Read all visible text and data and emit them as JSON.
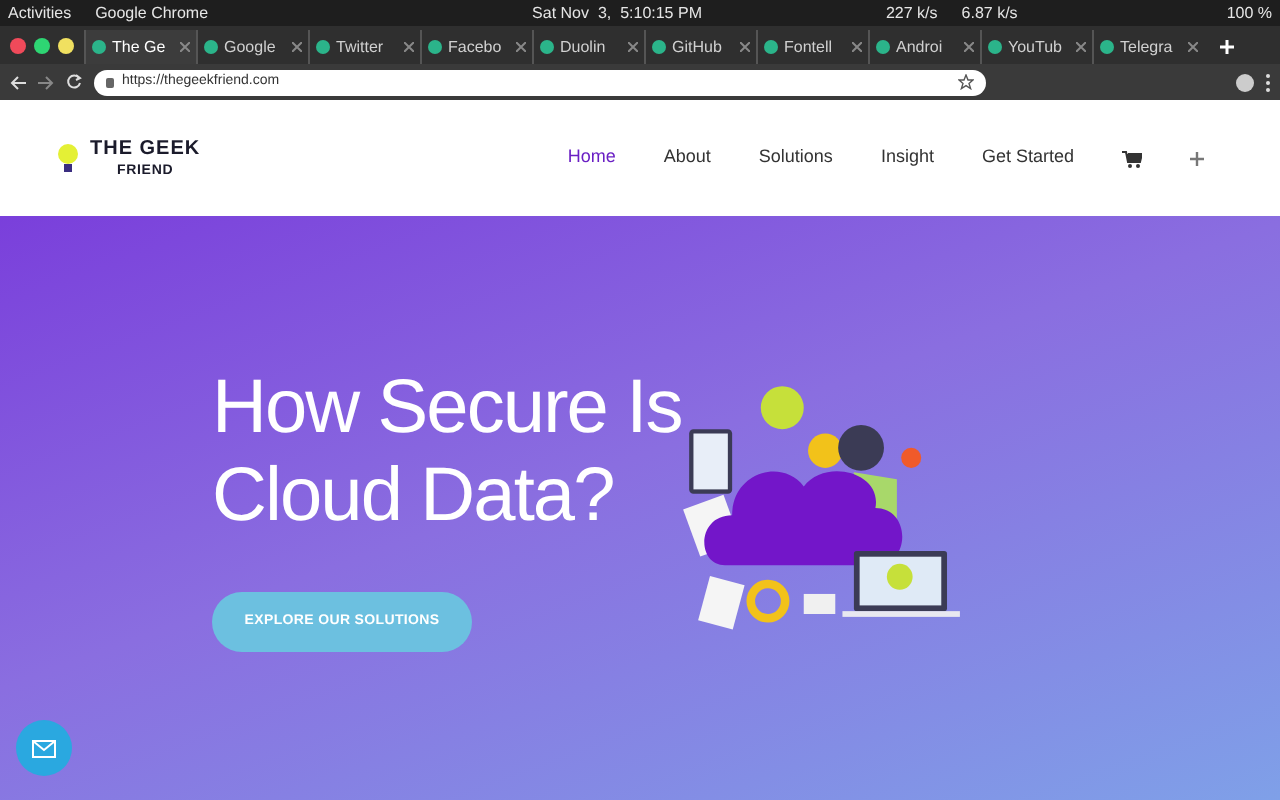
{
  "os_bar": {
    "activities": "Activities",
    "app": "Google Chrome",
    "clock": "Sat Nov  3,  5:10:15 PM",
    "download": "227 k/s",
    "upload": "6.87 k/s",
    "battery": "100 %"
  },
  "tabs": [
    {
      "label": "The Ge",
      "selected": true
    },
    {
      "label": "Google",
      "selected": false
    },
    {
      "label": "Twitter",
      "selected": false
    },
    {
      "label": "Facebo",
      "selected": false
    },
    {
      "label": "Duolin",
      "selected": false
    },
    {
      "label": "GitHub",
      "selected": false
    },
    {
      "label": "Fontell",
      "selected": false
    },
    {
      "label": "Androi",
      "selected": false
    },
    {
      "label": "YouTub",
      "selected": false
    },
    {
      "label": "Telegra",
      "selected": false
    }
  ],
  "address_bar": {
    "url": "https://thegeekfriend.com"
  },
  "site": {
    "logo_line1": "THE GEEK",
    "logo_line2": "FRIEND",
    "nav": [
      {
        "label": "Home",
        "selected": true
      },
      {
        "label": "About",
        "selected": false
      },
      {
        "label": "Solutions",
        "selected": false
      },
      {
        "label": "Insight",
        "selected": false
      },
      {
        "label": "Get Started",
        "selected": false
      }
    ]
  },
  "hero": {
    "title_line1": "How Secure Is",
    "title_line2": "Cloud Data?",
    "button": "EXPLORE OUR SOLUTIONS"
  }
}
